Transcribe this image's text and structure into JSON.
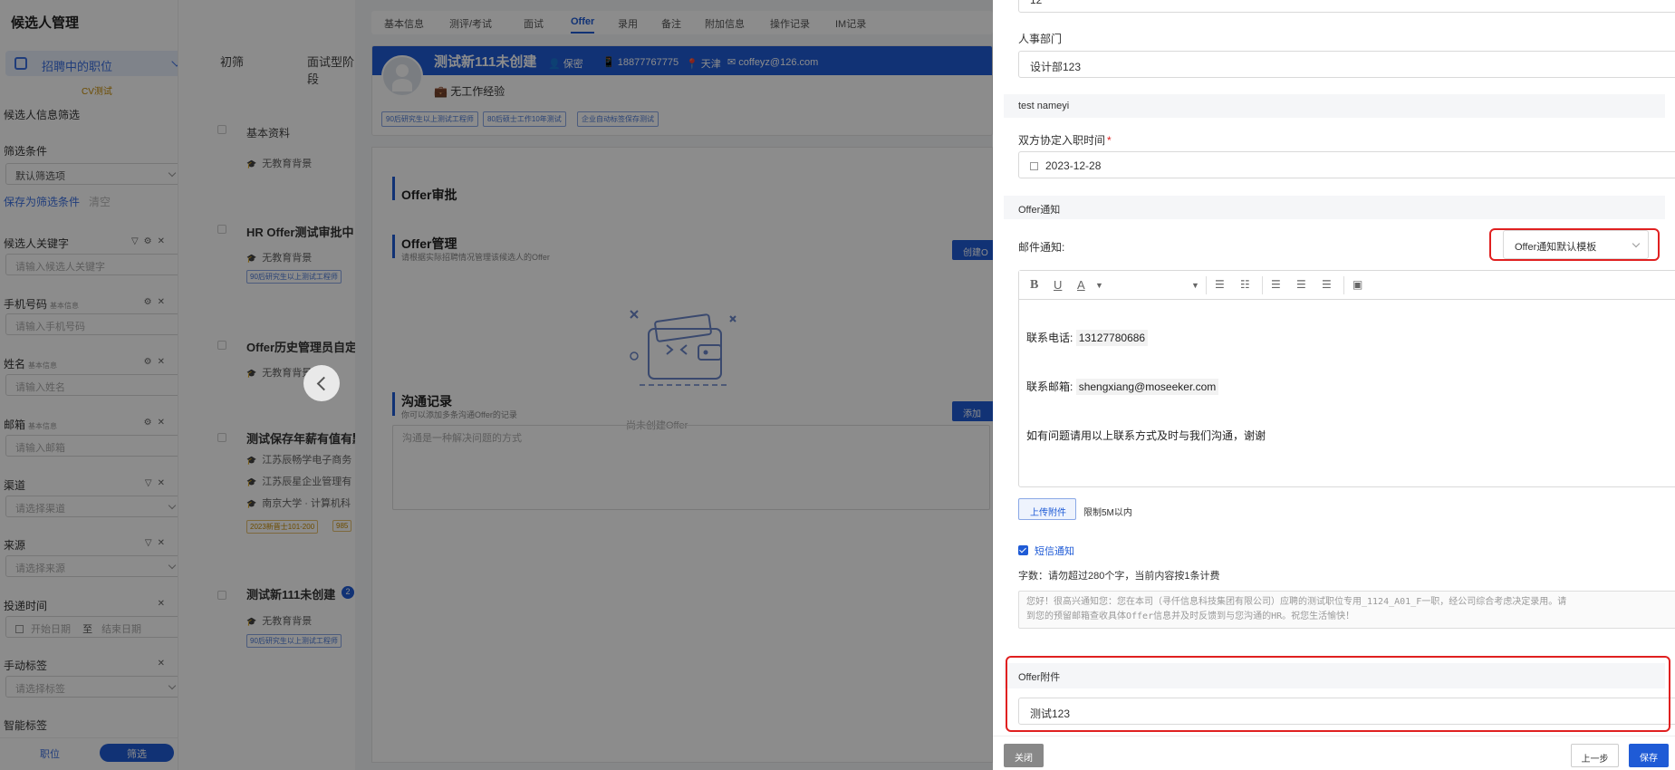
{
  "sidebar": {
    "title": "候选人管理",
    "job_select": "招聘中的职位",
    "cv_tag": "CV测试",
    "section_title": "候选人信息筛选",
    "filter_label": "筛选条件",
    "filter_value": "默认筛选项",
    "save_filter": "保存为筛选条件",
    "clear": "清空",
    "keyword_label": "候选人关键字",
    "keyword_placeholder": "请输入候选人关键字",
    "phone_label": "手机号码",
    "phone_sub": "基本信息",
    "phone_placeholder": "请输入手机号码",
    "name_label": "姓名",
    "name_sub": "基本信息",
    "name_placeholder": "请输入姓名",
    "email_label": "邮箱",
    "email_sub": "基本信息",
    "email_placeholder": "请输入邮箱",
    "channel_label": "渠道",
    "channel_placeholder": "请选择渠道",
    "source_label": "来源",
    "source_placeholder": "请选择来源",
    "apply_time_label": "投递时间",
    "start_date": "开始日期",
    "to": "至",
    "end_date": "结束日期",
    "manual_tag_label": "手动标签",
    "manual_tag_placeholder": "请选择标签",
    "smart_tag_label": "智能标签",
    "bottom_job": "职位",
    "bottom_filter": "筛选"
  },
  "middle": {
    "tabs": [
      "初筛",
      "面试型阶段"
    ],
    "header_col": "基本资料",
    "items": [
      {
        "title": "",
        "rows": [
          "无教育背景"
        ],
        "tags": []
      },
      {
        "title": "HR Offer测试审批中",
        "rows": [
          "无教育背景"
        ],
        "tags": [
          "90后研究生以上测试工程师"
        ]
      },
      {
        "title": "Offer历史管理员自定",
        "rows": [
          "无教育背景"
        ],
        "tags": []
      },
      {
        "title": "测试保存年薪有值有默",
        "rows": [
          "江苏辰畅学电子商务",
          "江苏辰星企业管理有",
          "南京大学 · 计算机科"
        ],
        "tags": [
          "2023新晋士101-200",
          "985"
        ]
      },
      {
        "title": "测试新111未创建",
        "rows": [
          "无教育背景"
        ],
        "tags": [
          "90后研究生以上测试工程师"
        ],
        "badge": "2"
      }
    ]
  },
  "center": {
    "tabs": [
      "基本信息",
      "测评/考试",
      "面试",
      "Offer",
      "录用",
      "备注",
      "附加信息",
      "操作记录",
      "IM记录"
    ],
    "active_tab": "Offer",
    "candidate": {
      "name": "测试新111未创建",
      "gender": "保密",
      "phone": "18877767775",
      "city": "天津",
      "email": "coffeyz@126.com",
      "experience": "无工作经验",
      "tags": [
        "90后研究生以上测试工程师",
        "80后硕士工作10年测试",
        "企业自动标签保存测试"
      ]
    },
    "offer_approval": "Offer审批",
    "offer_manage": "Offer管理",
    "offer_manage_sub": "请根据实际招聘情况管理该候选人的Offer",
    "create_btn": "创建O",
    "empty_text": "尚未创建Offer",
    "comm_title": "沟通记录",
    "comm_sub": "你可以添加多条沟通Offer的记录",
    "add_btn": "添加",
    "comm_placeholder": "沟通是一种解决问题的方式"
  },
  "drawer": {
    "top_value": "12",
    "hr_dept_label": "人事部门",
    "hr_dept_value": "设计部123",
    "group_test": "test nameyi",
    "join_date_label": "双方协定入职时间",
    "join_date_value": "2023-12-28",
    "group_notice": "Offer通知",
    "email_notice_label": "邮件通知:",
    "template_value": "Offer通知默认模板",
    "editor": {
      "phone_label": "联系电话:",
      "phone_value": "13127780686",
      "email_label": "联系邮箱:",
      "email_value": "shengxiang@moseeker.com",
      "closing": "如有问题请用以上联系方式及时与我们沟通，谢谢"
    },
    "upload_btn": "上传附件",
    "upload_hint": "限制5M以内",
    "sms_label": "短信通知",
    "word_count": "字数：请勿超过280个字，当前内容按1条计费",
    "sms_line1": "您好！很高兴通知您：您在本司（寻仟信息科技集团有限公司）应聘的测试职位专用_1124_A01_F一职，经公司综合考虑决定录用。请",
    "sms_line2": "到您的预留邮箱查收具体Offer信息并及时反馈到与您沟通的HR。祝您生活愉快！",
    "group_attach": "Offer附件",
    "attach_value": "测试123",
    "btn_close": "关闭",
    "btn_prev": "上一步",
    "btn_save": "保存"
  }
}
